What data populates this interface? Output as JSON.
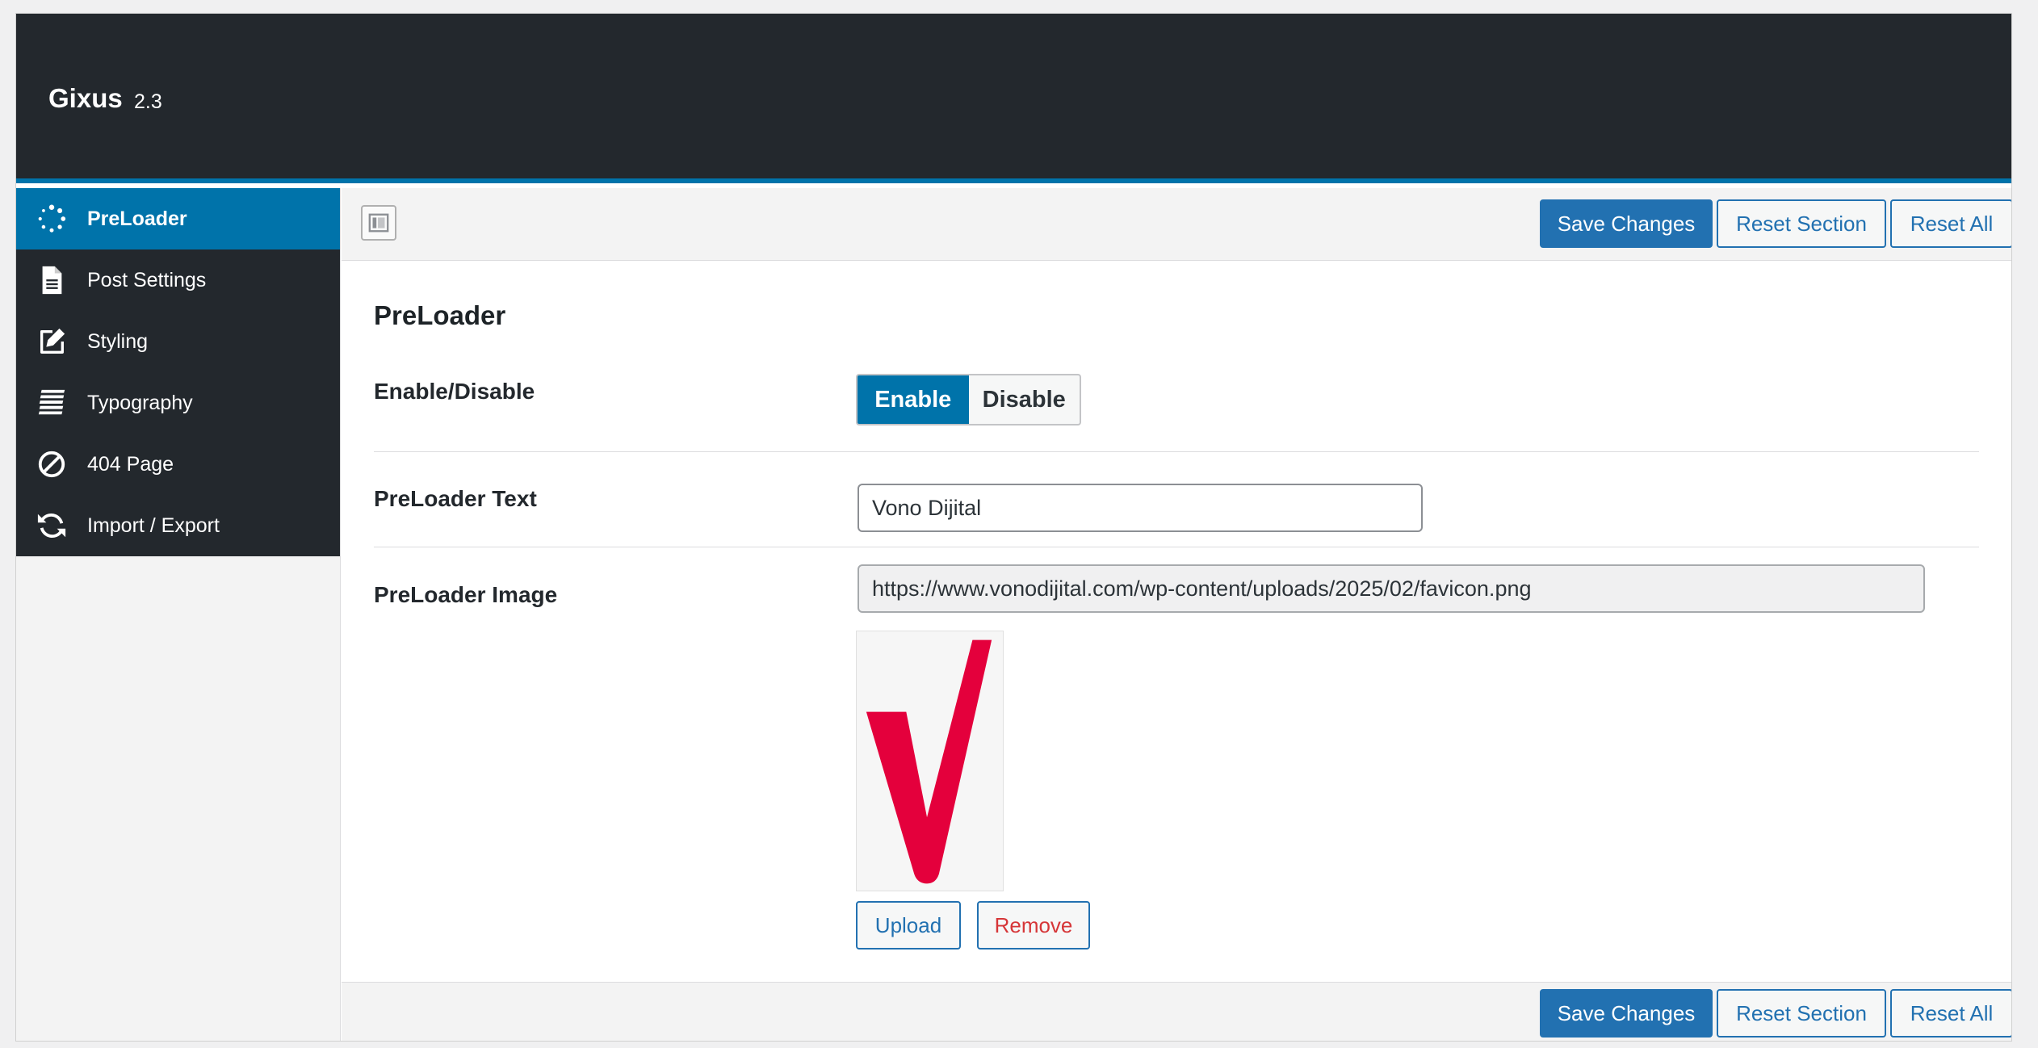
{
  "app": {
    "title": "Gixus",
    "version": "2.3"
  },
  "sidebar": {
    "items": [
      {
        "label": "PreLoader",
        "icon": "spinner-icon",
        "active": true
      },
      {
        "label": "Post Settings",
        "icon": "document-icon"
      },
      {
        "label": "Styling",
        "icon": "edit-icon"
      },
      {
        "label": "Typography",
        "icon": "text-lines-icon"
      },
      {
        "label": "404 Page",
        "icon": "ban-icon"
      },
      {
        "label": "Import / Export",
        "icon": "refresh-icon"
      }
    ]
  },
  "toolbar": {
    "save_label": "Save Changes",
    "reset_section_label": "Reset Section",
    "reset_all_label": "Reset All"
  },
  "section": {
    "title": "PreLoader",
    "enable": {
      "label": "Enable/Disable",
      "on_label": "Enable",
      "off_label": "Disable",
      "selected": "Enable"
    },
    "text": {
      "label": "PreLoader Text",
      "value": "Vono Dijital"
    },
    "image": {
      "label": "PreLoader Image",
      "url": "https://www.vonodijital.com/wp-content/uploads/2025/02/favicon.png",
      "upload_label": "Upload",
      "remove_label": "Remove"
    }
  },
  "footer": {
    "save_label": "Save Changes",
    "reset_section_label": "Reset Section",
    "reset_all_label": "Reset All"
  },
  "colors": {
    "header_bg": "#23282d",
    "accent": "#0073aa",
    "primary_button": "#2271b1",
    "remove": "#d63638",
    "logo_mark": "#e4003c"
  }
}
